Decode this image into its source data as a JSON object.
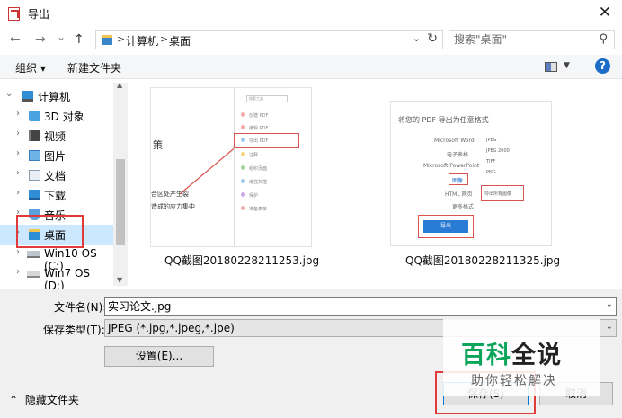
{
  "window": {
    "title": "导出",
    "close_glyph": "✕",
    "app_icon": "pdf-icon"
  },
  "nav": {
    "back": "←",
    "forward": "→",
    "history": "⌄",
    "up": "↑"
  },
  "address": {
    "crumbs": [
      "计算机",
      "桌面"
    ],
    "separators": [
      ">",
      ">"
    ]
  },
  "search": {
    "placeholder": "搜索\"桌面\""
  },
  "toolbar": {
    "organize": "组织 ▾",
    "new_folder": "新建文件夹",
    "help": "?"
  },
  "tree": {
    "items": [
      {
        "label": "计算机",
        "icon": "computer-icon",
        "arrow": "⌄"
      },
      {
        "label": "3D 对象",
        "icon": "3d-objects-icon",
        "arrow": "›"
      },
      {
        "label": "视频",
        "icon": "video-icon",
        "arrow": "›"
      },
      {
        "label": "图片",
        "icon": "pictures-icon",
        "arrow": "›"
      },
      {
        "label": "文档",
        "icon": "documents-icon",
        "arrow": "›"
      },
      {
        "label": "下载",
        "icon": "downloads-icon",
        "arrow": "›"
      },
      {
        "label": "音乐",
        "icon": "music-icon",
        "arrow": "›"
      },
      {
        "label": "桌面",
        "icon": "desktop-icon",
        "arrow": "›",
        "selected": true
      },
      {
        "label": "Win10 OS (C:)",
        "icon": "drive-icon",
        "arrow": "›"
      },
      {
        "label": "Win7 OS (D:)",
        "icon": "drive-icon",
        "arrow": "›"
      }
    ]
  },
  "files": [
    {
      "name": "QQ截图20180228211253.jpg",
      "preview": {
        "heading": "策",
        "search_box": "搜索工具",
        "menu": [
          "创建 PDF",
          "编辑 PDF",
          "导出 PDF",
          "注释",
          "组织页面",
          "增强扫描",
          "保护",
          "准备表单"
        ],
        "body_lines": [
          "合区处产生裂",
          "造成的应力集中"
        ]
      }
    },
    {
      "name": "QQ截图20180228211325.jpg",
      "preview": {
        "title": "将您的 PDF 导出为任意格式",
        "formats": [
          "Microsoft Word",
          "电子表格",
          "Microsoft PowerPoint",
          "图像",
          "HTML 网页",
          "更多格式"
        ],
        "options": [
          "JPEG",
          "JPEG 2000",
          "TIFF",
          "PNG"
        ],
        "checkbox": "导出所有图像",
        "export_button": "导出"
      }
    }
  ],
  "form": {
    "filename_label": "文件名(N):",
    "filename_value": "实习论文.jpg",
    "filetype_label": "保存类型(T):",
    "filetype_value": "JPEG (*.jpg,*.jpeg,*.jpe)",
    "settings_button": "设置(E)...",
    "hide_folders": "隐藏文件夹",
    "save_button": "保存(S)",
    "cancel_button": "取消",
    "dropdown_glyph": "⌄"
  },
  "watermark": {
    "accent_text": "百科",
    "main_text": "全说",
    "sub_text": "助你轻松解决"
  },
  "colors": {
    "accent": "#0078d7",
    "highlight": "#e03a3a",
    "selection": "#cce8ff",
    "watermark_green": "#0aa55a"
  }
}
